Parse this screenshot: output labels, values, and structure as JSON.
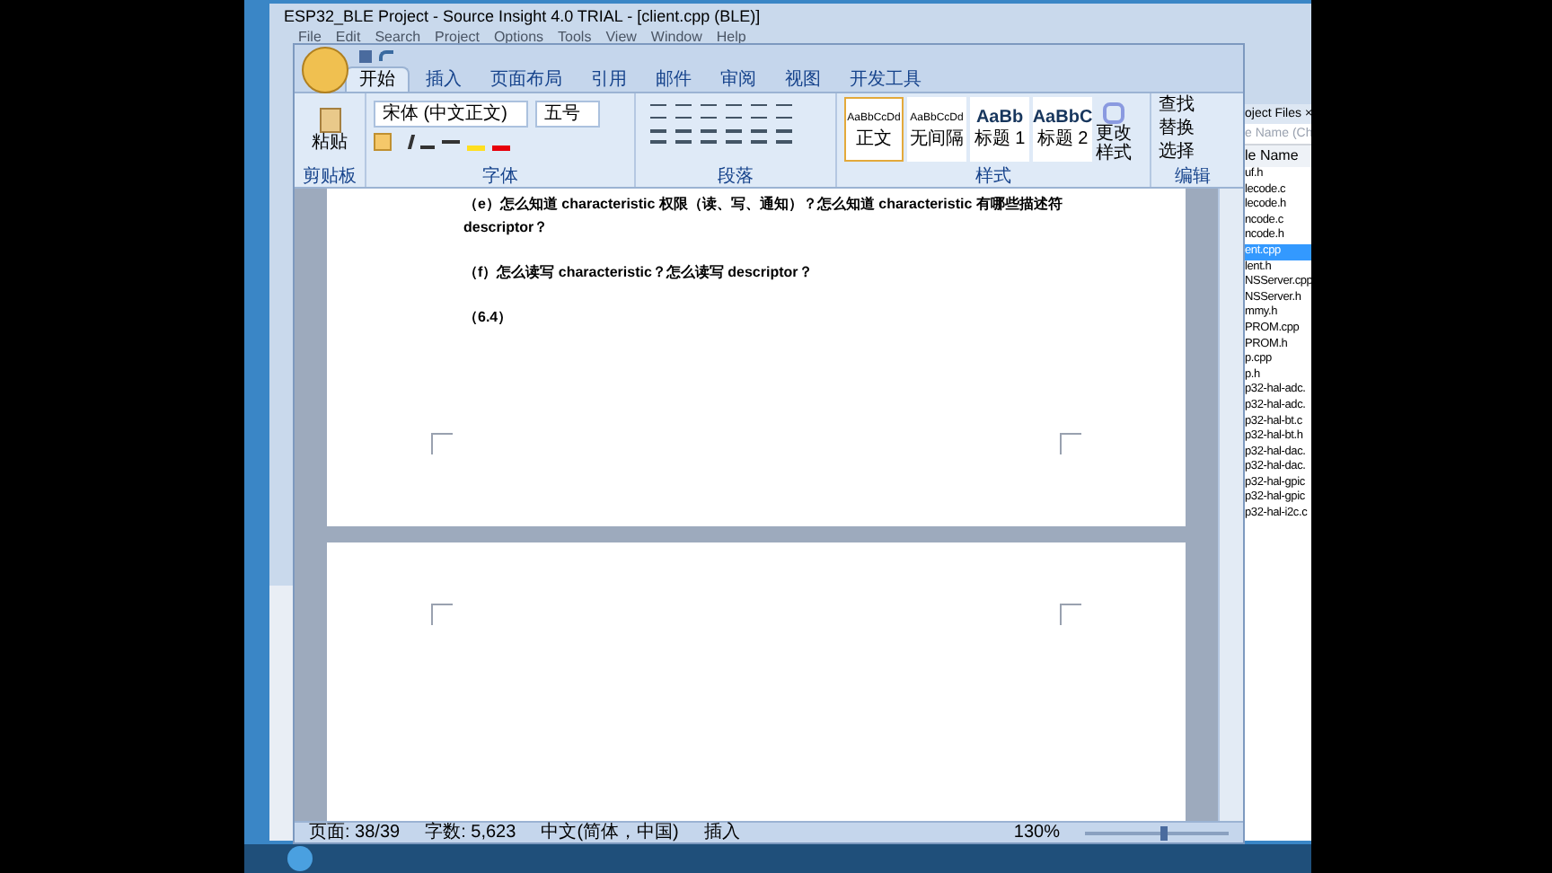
{
  "source_insight": {
    "title": "ESP32_BLE Project - Source Insight 4.0 TRIAL - [client.cpp (BLE)]",
    "menu": [
      "File",
      "Edit",
      "Search",
      "Project",
      "Options",
      "Tools",
      "View",
      "Window",
      "Help"
    ],
    "panel_title": "oject Files ×",
    "search_placeholder": "e Name (Ch",
    "column": "le Name",
    "files": [
      {
        "name": "uf.h",
        "selected": false
      },
      {
        "name": "lecode.c",
        "selected": false
      },
      {
        "name": "lecode.h",
        "selected": false
      },
      {
        "name": "ncode.c",
        "selected": false
      },
      {
        "name": "ncode.h",
        "selected": false
      },
      {
        "name": "ent.cpp",
        "selected": true
      },
      {
        "name": "lent.h",
        "selected": false
      },
      {
        "name": "NSServer.cpp",
        "selected": false
      },
      {
        "name": "NSServer.h",
        "selected": false
      },
      {
        "name": "mmy.h",
        "selected": false
      },
      {
        "name": "PROM.cpp",
        "selected": false
      },
      {
        "name": "PROM.h",
        "selected": false
      },
      {
        "name": "p.cpp",
        "selected": false
      },
      {
        "name": "p.h",
        "selected": false
      },
      {
        "name": "p32-hal-adc.",
        "selected": false
      },
      {
        "name": "p32-hal-adc.",
        "selected": false
      },
      {
        "name": "p32-hal-bt.c",
        "selected": false
      },
      {
        "name": "p32-hal-bt.h",
        "selected": false
      },
      {
        "name": "p32-hal-dac.",
        "selected": false
      },
      {
        "name": "p32-hal-dac.",
        "selected": false
      },
      {
        "name": "p32-hal-gpic",
        "selected": false
      },
      {
        "name": "p32-hal-gpic",
        "selected": false
      },
      {
        "name": "p32-hal-i2c.c",
        "selected": false
      }
    ]
  },
  "word": {
    "tabs": [
      {
        "label": "开始",
        "selected": true
      },
      {
        "label": "插入",
        "selected": false
      },
      {
        "label": "页面布局",
        "selected": false
      },
      {
        "label": "引用",
        "selected": false
      },
      {
        "label": "邮件",
        "selected": false
      },
      {
        "label": "审阅",
        "selected": false
      },
      {
        "label": "视图",
        "selected": false
      },
      {
        "label": "开发工具",
        "selected": false
      }
    ],
    "paste": "粘贴",
    "font": "宋体 (中文正文)",
    "size": "五号",
    "styles": [
      {
        "preview": "AaBbCcDd",
        "name": "正文",
        "selected": true
      },
      {
        "preview": "AaBbCcDd",
        "name": "无间隔",
        "selected": false
      },
      {
        "preview": "AaBb",
        "name": "标题 1",
        "selected": false
      },
      {
        "preview": "AaBbC",
        "name": "标题 2",
        "selected": false
      }
    ],
    "change_styles": "更改样式",
    "editing": [
      "查找",
      "替换",
      "选择"
    ],
    "groups": [
      "剪贴板",
      "字体",
      "段落",
      "样式",
      "编辑"
    ],
    "paragraphs": [
      "（e）怎么知道 characteristic 权限（读、写、通知）？怎么知道 characteristic 有哪些描述符 descriptor？",
      "（f）怎么读写 characteristic？怎么读写 descriptor？",
      "（6.4）"
    ],
    "status": {
      "page": "页面: 38/39",
      "words": "字数: 5,623",
      "language": "中文(简体，中国)",
      "mode": "插入",
      "zoom": "130%",
      "zoom_slider": {
        "level": 0.55
      }
    }
  }
}
